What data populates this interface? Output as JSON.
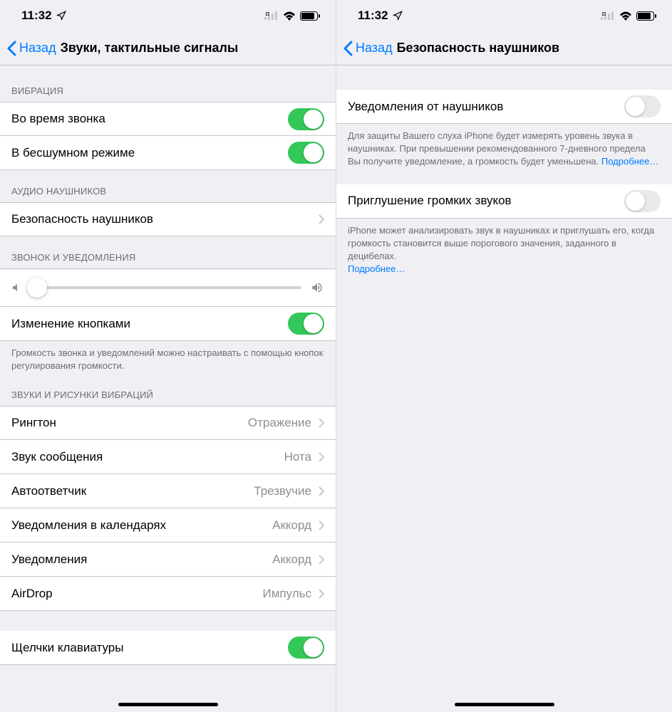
{
  "statusbar": {
    "time": "11:32"
  },
  "left": {
    "back": "Назад",
    "title": "Звуки, тактильные сигналы",
    "sections": {
      "vibration": {
        "header": "ВИБРАЦИЯ",
        "ring": "Во время звонка",
        "silent": "В бесшумном режиме"
      },
      "headphoneAudio": {
        "header": "АУДИО НАУШНИКОВ",
        "safety": "Безопасность наушников"
      },
      "ringer": {
        "header": "ЗВОНОК И УВЕДОМЛЕНИЯ",
        "buttons": "Изменение кнопками",
        "footer": "Громкость звонка и уведомлений можно настраивать с помощью кнопок регулирования громкости."
      },
      "sounds": {
        "header": "ЗВУКИ И РИСУНКИ ВИБРАЦИЙ",
        "items": [
          {
            "label": "Рингтон",
            "value": "Отражение"
          },
          {
            "label": "Звук сообщения",
            "value": "Нота"
          },
          {
            "label": "Автоответчик",
            "value": "Трезвучие"
          },
          {
            "label": "Уведомления в календарях",
            "value": "Аккорд"
          },
          {
            "label": "Уведомления",
            "value": "Аккорд"
          },
          {
            "label": "AirDrop",
            "value": "Импульс"
          }
        ],
        "keyboard": "Щелчки клавиатуры"
      }
    }
  },
  "right": {
    "back": "Назад",
    "title": "Безопасность наушников",
    "notifications": {
      "label": "Уведомления от наушников",
      "footer": "Для защиты Вашего слуха iPhone будет измерять уровень звука в наушниках. При превышении рекомендованного 7-дневного предела Вы получите уведомление, а громкость будет уменьшена. ",
      "link": "Подробнее…"
    },
    "reduce": {
      "label": "Приглушение громких звуков",
      "footer": "iPhone может анализировать звук в наушниках и приглушать его, когда громкость становится выше порогового значения, заданного в децибелах.",
      "link": "Подробнее…"
    }
  }
}
